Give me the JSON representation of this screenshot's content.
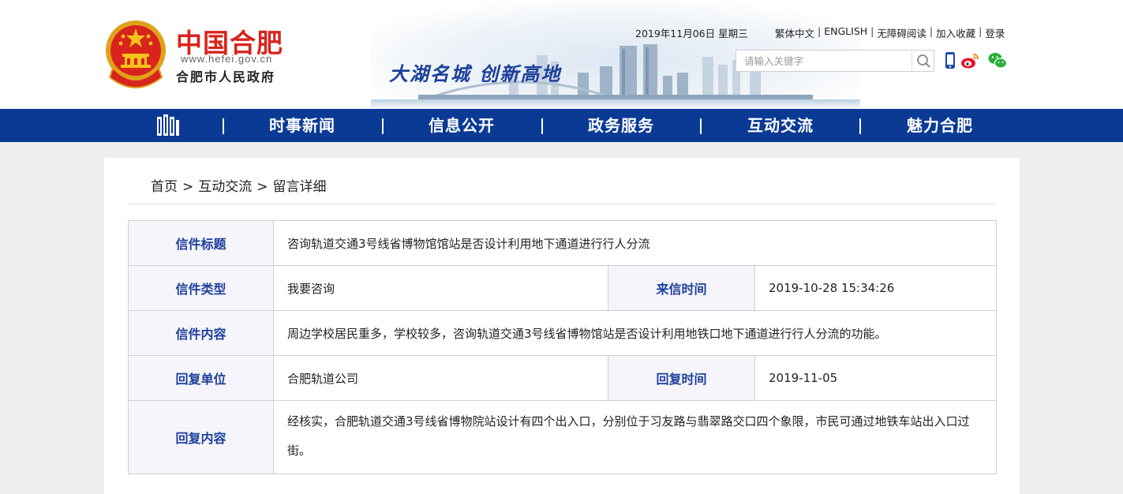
{
  "header": {
    "site_name": "中国合肥",
    "site_url": "www.hefei.gov.cn",
    "site_org": "合肥市人民政府",
    "slogan": "大湖名城  创新高地",
    "date": "2019年11月06日 星期三",
    "top_links": [
      "繁体中文",
      "ENGLISH",
      "无障碍阅读",
      "加入收藏",
      "登录"
    ],
    "search_placeholder": "请输入关键字",
    "icons": [
      "mobile-icon",
      "weibo-icon",
      "wechat-icon",
      "search-icon",
      "emblem-icon"
    ]
  },
  "nav": {
    "items": [
      "时事新闻",
      "信息公开",
      "政务服务",
      "互动交流",
      "魅力合肥"
    ],
    "color": "#0b3a95"
  },
  "breadcrumb": [
    "首页",
    "互动交流",
    "留言详细"
  ],
  "letter": {
    "title_label": "信件标题",
    "title": "咨询轨道交通3号线省博物馆馆站是否设计利用地下通道进行行人分流",
    "type_label": "信件类型",
    "type": "我要咨询",
    "time_label": "来信时间",
    "time": "2019-10-28 15:34:26",
    "content_label": "信件内容",
    "content": "周边学校居民重多，学校较多，咨询轨道交通3号线省博物馆站是否设计利用地铁口地下通道进行行人分流的功能。",
    "reply_unit_label": "回复单位",
    "reply_unit": "合肥轨道公司",
    "reply_time_label": "回复时间",
    "reply_time": "2019-11-05",
    "reply_content_label": "回复内容",
    "reply_content": "经核实，合肥轨道交通3号线省博物院站设计有四个出入口，分别位于习友路与翡翠路交口四个象限，市民可通过地铁车站出入口过街。"
  },
  "colors": {
    "brand_red": "#d8241c",
    "nav_blue": "#0b3a95",
    "label_blue": "#1e3f9c"
  }
}
